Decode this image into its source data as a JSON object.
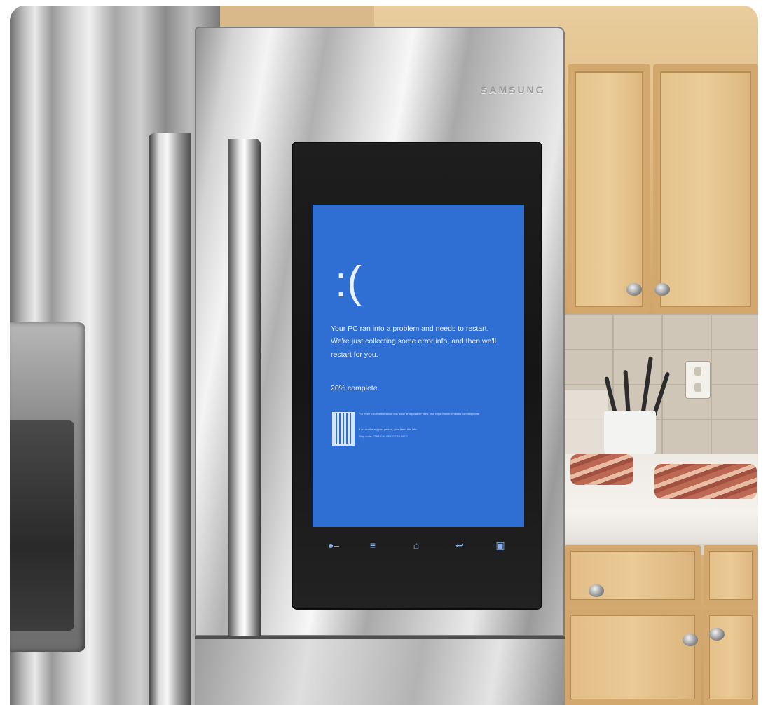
{
  "fridge": {
    "brand_label": "SAMSUNG"
  },
  "screen": {
    "background": "#2f6fd3",
    "face": ":(",
    "message": "Your PC ran into a problem and needs to restart. We're just collecting some error info, and then we'll restart for you.",
    "progress": "20% complete",
    "fine_line_1": "For more information about this issue and possible fixes, visit https://www.windows.com/stopcode",
    "fine_line_2": "If you call a support person, give them this info:",
    "fine_line_3": "Stop code: CRITICAL PROCESS DIED",
    "nav_icons": [
      "microphone-icon",
      "menu-icon",
      "home-icon",
      "back-icon",
      "apps-icon"
    ]
  }
}
